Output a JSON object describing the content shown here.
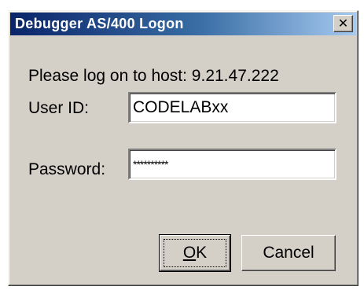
{
  "window": {
    "title": "Debugger AS/400 Logon",
    "close_icon": "close-icon"
  },
  "prompt": {
    "text": "Please log on to host: 9.21.47.222"
  },
  "userid": {
    "label": "User ID:",
    "value": "CODELABxx"
  },
  "password": {
    "label": "Password:",
    "value": "**********"
  },
  "buttons": {
    "ok_mnemonic": "O",
    "ok_rest": "K",
    "cancel": "Cancel"
  }
}
